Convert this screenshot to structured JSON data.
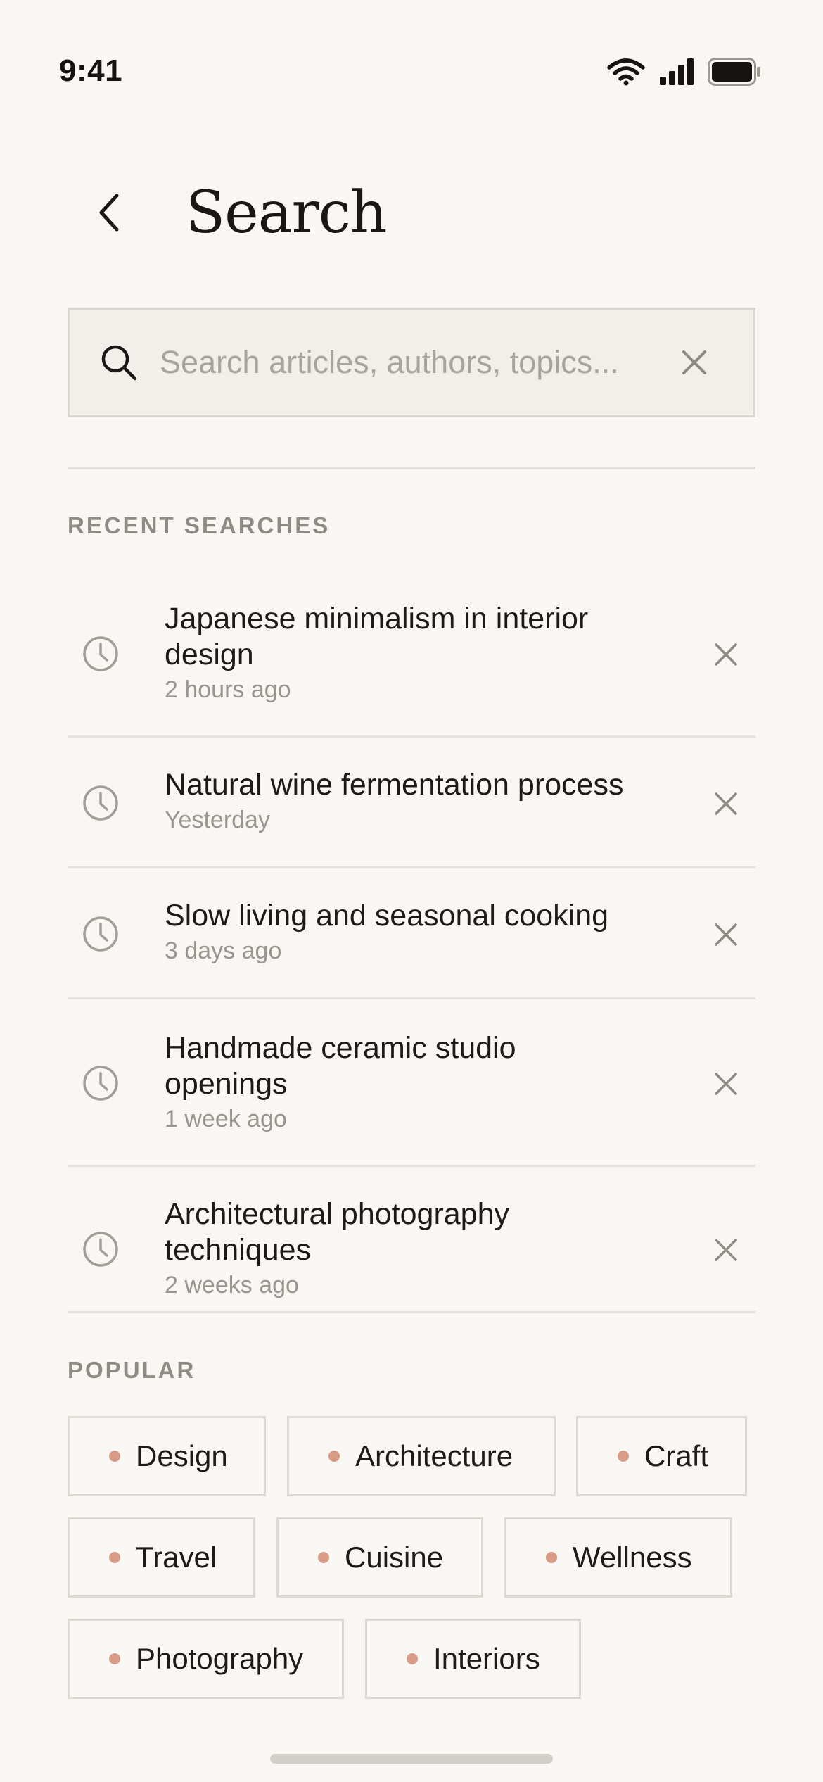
{
  "status_bar": {
    "time": "9:41",
    "icons": [
      "wifi-icon",
      "cellular-signal-icon",
      "battery-icon"
    ]
  },
  "header": {
    "back_icon": "chevron-left-icon",
    "title": "Search"
  },
  "search": {
    "placeholder": "Search articles, authors, topics...",
    "value": "",
    "search_icon": "search-icon",
    "clear_icon": "close-icon"
  },
  "recent": {
    "label": "RECENT SEARCHES",
    "items": [
      {
        "title": "Japanese minimalism in interior design",
        "time": "2 hours ago"
      },
      {
        "title": "Natural wine fermentation process",
        "time": "Yesterday"
      },
      {
        "title": "Slow living and seasonal cooking",
        "time": "3 days ago"
      },
      {
        "title": "Handmade ceramic studio openings",
        "time": "1 week ago"
      },
      {
        "title": "Architectural photography techniques",
        "time": "2 weeks ago"
      }
    ]
  },
  "popular": {
    "label": "POPULAR",
    "tags": [
      "Design",
      "Architecture",
      "Craft",
      "Travel",
      "Cuisine",
      "Wellness",
      "Photography",
      "Interiors"
    ]
  },
  "colors": {
    "background": "#f9f7f3",
    "accent_dot": "#d79b86",
    "text_primary": "#1d1b19",
    "text_secondary": "#9a958f",
    "border": "#dcd8d2"
  }
}
